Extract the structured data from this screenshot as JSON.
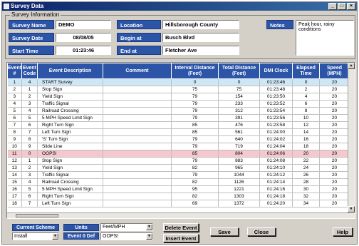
{
  "window": {
    "title": "Survey Data",
    "buttons": [
      "_",
      "□",
      "×"
    ]
  },
  "survey_info": {
    "group_label": "Survey Information",
    "survey_name_label": "Survey Name",
    "survey_name": "DEMO",
    "survey_date_label": "Survey Date",
    "survey_date": "08/08/05",
    "start_time_label": "Start Time",
    "start_time": "01:23:46",
    "location_label": "Location",
    "location": "Hillsborough County",
    "begin_label": "Begin at",
    "begin": "Busch Blvd",
    "end_label": "End at",
    "end": "Fletcher Ave",
    "notes_label": "Notes",
    "notes": "Peak hour, rainy conditions"
  },
  "grid": {
    "columns": [
      "Event #",
      "Event Code",
      "Event Description",
      "Comment",
      "Interval Distance (Feet)",
      "Total Distance (Feet)",
      "DMI Clock",
      "Elapsed Time",
      "Speed (MPH)"
    ],
    "rows": [
      [
        "1",
        "4",
        "START Survey",
        "",
        "0",
        "0",
        "01:23:46",
        "0",
        "20"
      ],
      [
        "2",
        "1",
        "Stop Sign",
        "",
        "75",
        "75",
        "01:23:48",
        "2",
        "20"
      ],
      [
        "3",
        "2",
        "Yield Sign",
        "",
        "79",
        "154",
        "01:23:50",
        "4",
        "20"
      ],
      [
        "4",
        "3",
        "Traffic Signal",
        "",
        "79",
        "233",
        "01:23:52",
        "6",
        "20"
      ],
      [
        "5",
        "4",
        "Railroad Crossing",
        "",
        "79",
        "312",
        "01:23:54",
        "8",
        "20"
      ],
      [
        "6",
        "5",
        "5 MPH Speed Limit Sign",
        "",
        "79",
        "391",
        "01:23:56",
        "10",
        "20"
      ],
      [
        "7",
        "6",
        "Right Turn Sign",
        "",
        "85",
        "476",
        "01:23:58",
        "12",
        "20"
      ],
      [
        "8",
        "7",
        "Left Turn Sign",
        "",
        "85",
        "561",
        "01:24:00",
        "14",
        "20"
      ],
      [
        "9",
        "8",
        "'S' Turn Sign",
        "",
        "79",
        "640",
        "01:24:02",
        "16",
        "20"
      ],
      [
        "10",
        "9",
        "Slide Line",
        "",
        "79",
        "719",
        "01:24:04",
        "18",
        "20"
      ],
      [
        "11",
        "0",
        "OOPS!",
        "",
        "85",
        "804",
        "01:24:06",
        "20",
        "20"
      ],
      [
        "12",
        "1",
        "Stop Sign",
        "",
        "79",
        "883",
        "01:24:08",
        "22",
        "20"
      ],
      [
        "13",
        "2",
        "Yield Sign",
        "",
        "82",
        "965",
        "01:24:10",
        "24",
        "20"
      ],
      [
        "14",
        "3",
        "Traffic Signal",
        "",
        "79",
        "1044",
        "01:24:12",
        "26",
        "20"
      ],
      [
        "15",
        "4",
        "Railroad Crossing",
        "",
        "82",
        "1126",
        "01:24:14",
        "28",
        "20"
      ],
      [
        "16",
        "5",
        "5 MPH Speed Limit Sign",
        "",
        "95",
        "1221",
        "01:24:16",
        "30",
        "20"
      ],
      [
        "17",
        "6",
        "Right Turn Sign",
        "",
        "82",
        "1303",
        "01:24:18",
        "32",
        "20"
      ],
      [
        "18",
        "7",
        "Left Turn Sign",
        "",
        "69",
        "1372",
        "01:24:20",
        "34",
        "20"
      ]
    ]
  },
  "bottom": {
    "current_scheme_label": "Current Scheme",
    "current_scheme_value": "Install",
    "units_label": "Units",
    "units_value": "Feet/MPH",
    "event_0_label": "Event 0 Def",
    "event_0_value": "OOPS!",
    "delete_event": "Delete Event",
    "insert_event": "Insert Event",
    "save": "Save",
    "close": "Close",
    "help": "Help"
  }
}
